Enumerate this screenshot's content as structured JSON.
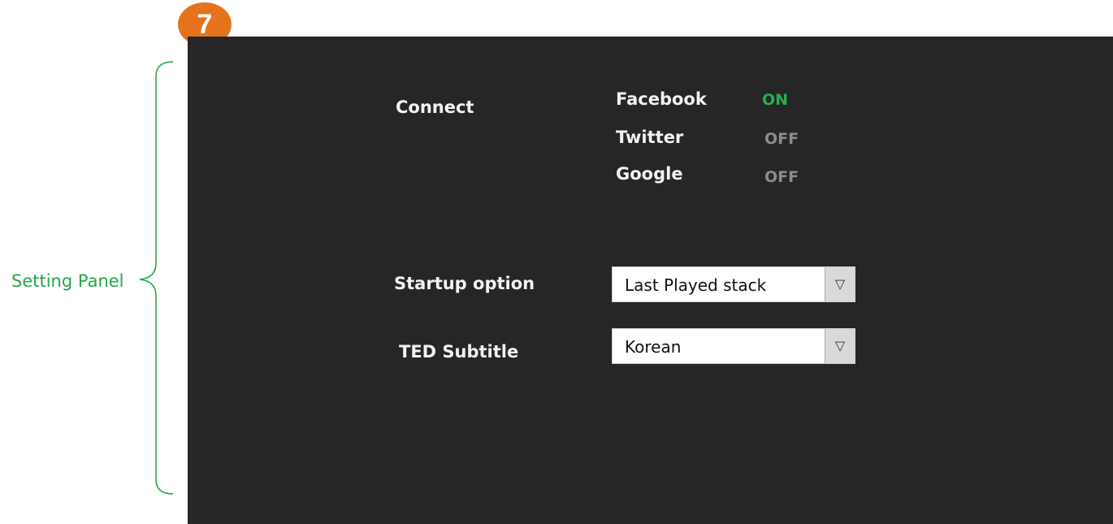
{
  "annotation": {
    "label": "Setting Panel"
  },
  "badge": {
    "number": "7",
    "color": "#e5731d"
  },
  "connect": {
    "label": "Connect",
    "services": [
      {
        "name": "Facebook",
        "status": "ON",
        "color": "#22b14c"
      },
      {
        "name": "Twitter",
        "status": "OFF",
        "color": "#8c8c8c"
      },
      {
        "name": "Google",
        "status": "OFF",
        "color": "#8c8c8c"
      }
    ]
  },
  "startup": {
    "label": "Startup option",
    "value": "Last Played stack",
    "icon": "chevron-down-icon"
  },
  "subtitle": {
    "label": "TED Subtitle",
    "value": "Korean",
    "icon": "chevron-down-icon"
  }
}
